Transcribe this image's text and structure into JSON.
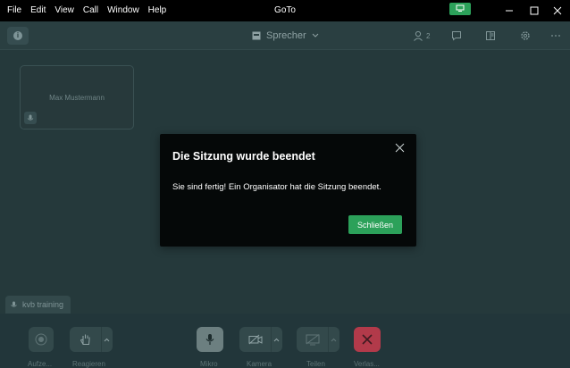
{
  "menu": [
    "File",
    "Edit",
    "View",
    "Call",
    "Window",
    "Help"
  ],
  "app_title": "GoTo",
  "window_controls": {
    "minimize_icon": "minimize-icon",
    "maximize_icon": "maximize-icon",
    "close_icon": "close-icon"
  },
  "toolbar": {
    "layout_label": "Sprecher",
    "participant_count": "2"
  },
  "tile": {
    "name": "Max Mustermann"
  },
  "name_label": "kvb training",
  "controls": {
    "record": "Aufze...",
    "react": "Reagieren",
    "mic": "Mikro",
    "camera": "Kamera",
    "share": "Teilen",
    "leave": "Verlas..."
  },
  "modal": {
    "title": "Die Sitzung wurde beendet",
    "body": "Sie sind fertig! Ein Organisator hat die Sitzung beendet.",
    "button": "Schließen"
  },
  "colors": {
    "accent": "#2ca15a",
    "leave": "#b23a4a"
  }
}
